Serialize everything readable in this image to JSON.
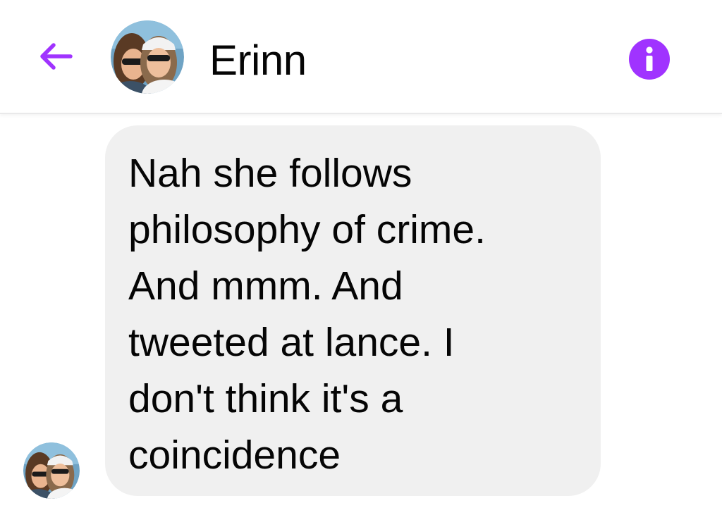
{
  "header": {
    "contact_name": "Erinn",
    "accent_color": "#a033ff"
  },
  "conversation": {
    "messages": [
      {
        "sender": "Erinn",
        "text": "Nah she follows\nphilosophy of crime.\nAnd mmm. And\ntweeted at lance. I\ndon't think it's a\ncoincidence"
      }
    ]
  },
  "icons": {
    "back": "back-arrow-icon",
    "info": "info-icon"
  }
}
